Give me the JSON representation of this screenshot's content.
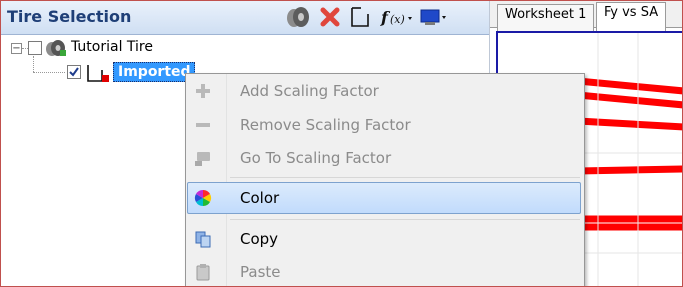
{
  "panel": {
    "title": "Tire Selection"
  },
  "tree": {
    "root_label": "Tutorial Tire",
    "child_label": "Imported Tire Data"
  },
  "worksheet": {
    "tabs": [
      {
        "label": "Worksheet 1"
      },
      {
        "label": "Fy vs SA"
      }
    ]
  },
  "context_menu": {
    "items": [
      {
        "label": "Add Scaling Factor",
        "enabled": false
      },
      {
        "label": "Remove Scaling Factor",
        "enabled": false
      },
      {
        "label": "Go To Scaling Factor",
        "enabled": false
      },
      {
        "label": "Color",
        "enabled": true,
        "highlighted": true
      },
      {
        "label": "Copy",
        "enabled": true
      },
      {
        "label": "Paste",
        "enabled": false
      }
    ]
  },
  "colors": {
    "accent_red": "#ff0000",
    "selection_blue": "#3399ff",
    "header_text": "#1f3f77"
  }
}
